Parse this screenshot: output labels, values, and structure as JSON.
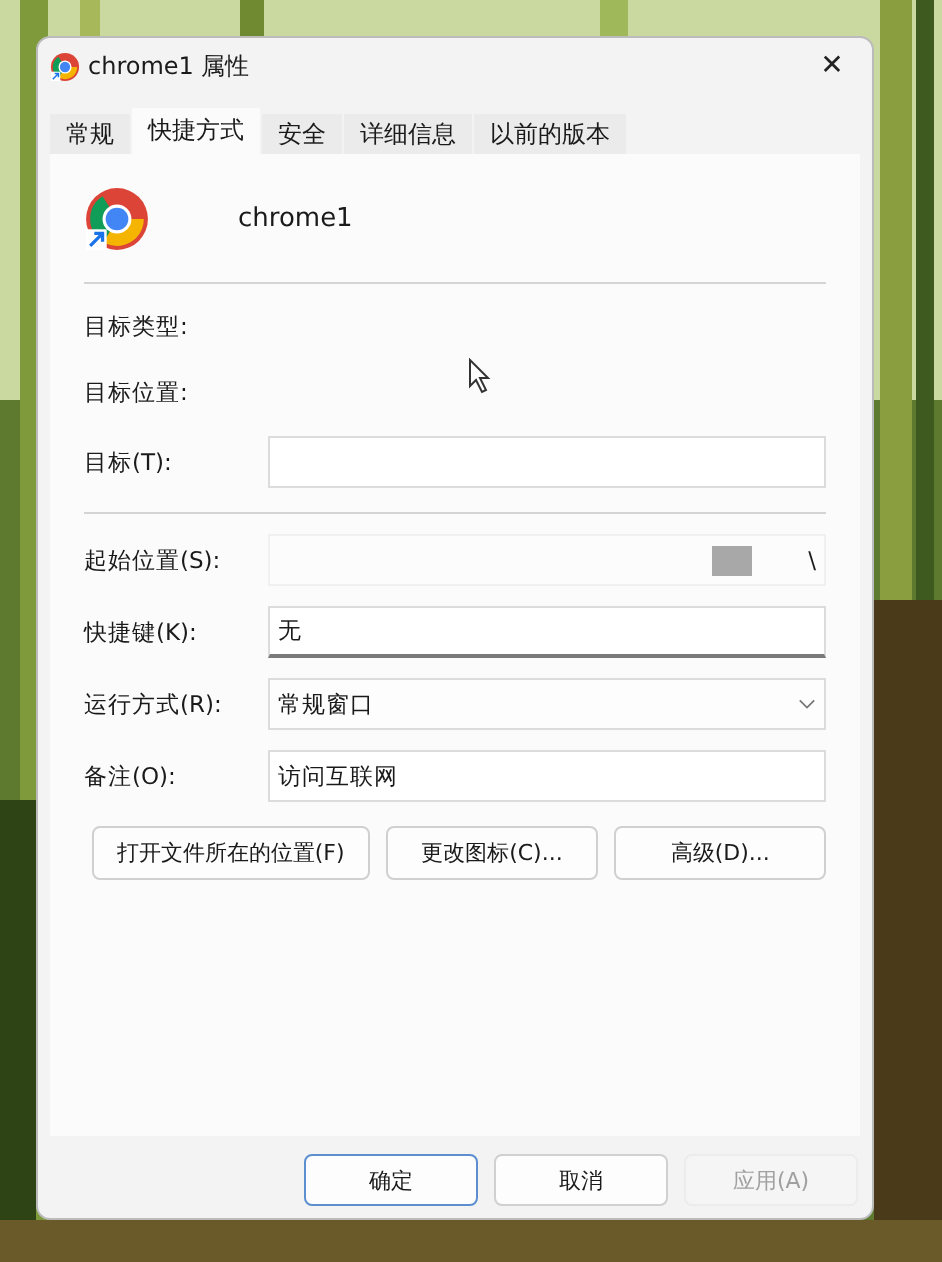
{
  "window": {
    "title": "chrome1 属性",
    "close": "✕"
  },
  "tabs": [
    {
      "label": "常规",
      "selected": false
    },
    {
      "label": "快捷方式",
      "selected": true
    },
    {
      "label": "安全",
      "selected": false
    },
    {
      "label": "详细信息",
      "selected": false
    },
    {
      "label": "以前的版本",
      "selected": false
    }
  ],
  "shortcut_name": "chrome1",
  "info_rows": [
    {
      "kind": "static",
      "label": "目标类型:"
    },
    {
      "kind": "static",
      "label": "目标位置:"
    },
    {
      "kind": "text",
      "label": "目标(T):",
      "value": ""
    },
    {
      "kind": "divider"
    },
    {
      "kind": "start",
      "label": "起始位置(S):",
      "value": "\\"
    },
    {
      "kind": "text",
      "label": "快捷键(K):",
      "value": "无",
      "focused": true
    },
    {
      "kind": "select",
      "label": "运行方式(R):",
      "value": "常规窗口"
    },
    {
      "kind": "text",
      "label": "备注(O):",
      "value": "访问互联网"
    }
  ],
  "action_buttons": [
    "打开文件所在的位置(F)",
    "更改图标(C)...",
    "高级(D)..."
  ],
  "footer_buttons": [
    {
      "label": "确定",
      "default": true,
      "disabled": false
    },
    {
      "label": "取消",
      "default": false,
      "disabled": false
    },
    {
      "label": "应用(A)",
      "default": false,
      "disabled": true
    }
  ]
}
